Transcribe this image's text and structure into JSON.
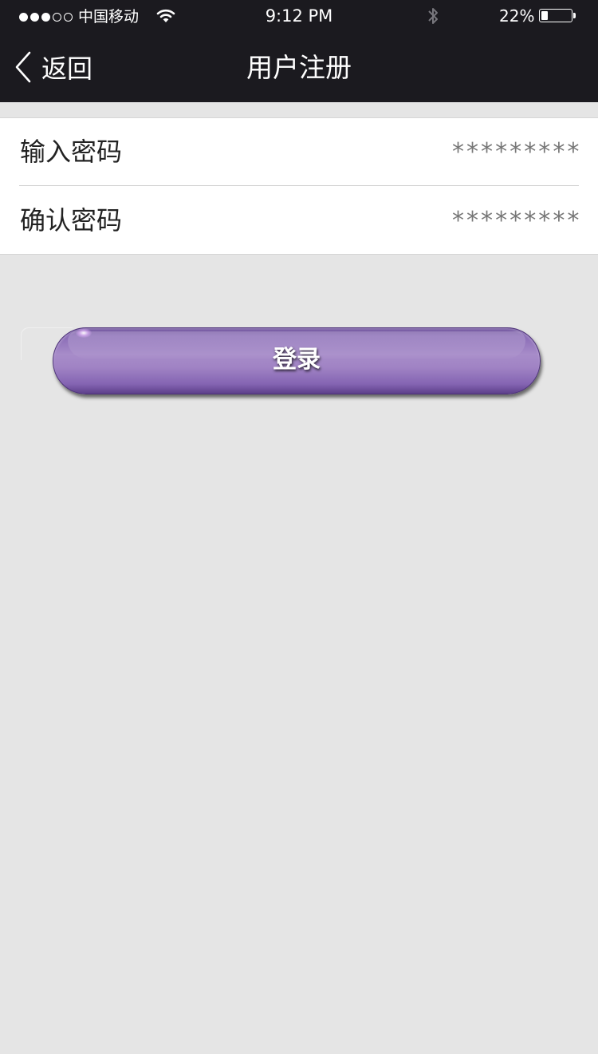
{
  "status_bar": {
    "carrier": "中国移动",
    "signal_bars_filled": 3,
    "signal_bars_total": 5,
    "time": "9:12 PM",
    "battery_percent_label": "22%",
    "battery_level": 0.22,
    "icons": [
      "wifi-icon",
      "bluetooth-icon",
      "battery-icon"
    ]
  },
  "nav": {
    "back_label": "返回",
    "title": "用户注册"
  },
  "form": {
    "password": {
      "label": "输入密码",
      "value": "*********"
    },
    "confirm_password": {
      "label": "确认密码",
      "value": "*********"
    }
  },
  "actions": {
    "login_label": "登录"
  },
  "colors": {
    "header_bg": "#1b1a1f",
    "page_bg": "#e5e5e5",
    "button_purple": "#8f72bb"
  }
}
